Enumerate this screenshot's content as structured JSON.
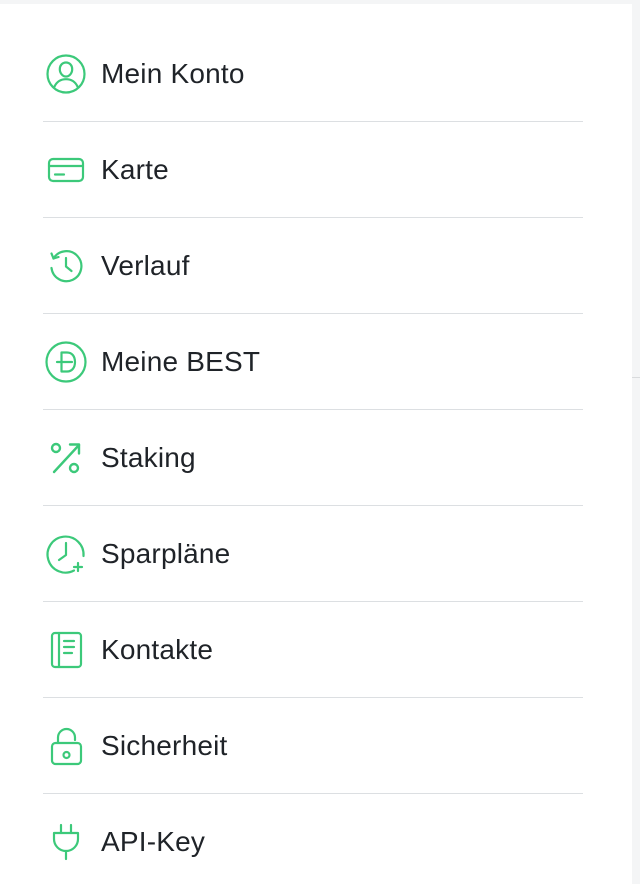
{
  "theme": {
    "accent": "#3cc97a",
    "text": "#1f2328",
    "divider": "#dcdfe2"
  },
  "menu": {
    "items": [
      {
        "label": "Mein Konto",
        "icon": "user-circle-icon"
      },
      {
        "label": "Karte",
        "icon": "credit-card-icon"
      },
      {
        "label": "Verlauf",
        "icon": "history-icon"
      },
      {
        "label": "Meine BEST",
        "icon": "best-coin-icon"
      },
      {
        "label": "Staking",
        "icon": "percent-up-icon"
      },
      {
        "label": "Sparpläne",
        "icon": "clock-plus-icon"
      },
      {
        "label": "Kontakte",
        "icon": "address-book-icon"
      },
      {
        "label": "Sicherheit",
        "icon": "lock-icon"
      },
      {
        "label": "API-Key",
        "icon": "plug-icon"
      }
    ]
  }
}
